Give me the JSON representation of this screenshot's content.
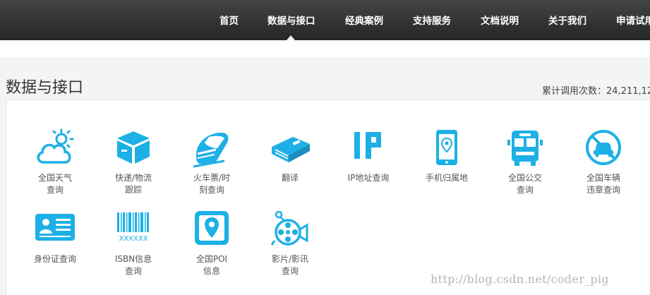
{
  "nav": {
    "items": [
      {
        "label": "首页",
        "active": false
      },
      {
        "label": "数据与接口",
        "active": true
      },
      {
        "label": "经典案例",
        "active": false
      },
      {
        "label": "支持服务",
        "active": false
      },
      {
        "label": "文档说明",
        "active": false
      },
      {
        "label": "关于我们",
        "active": false
      },
      {
        "label": "申请试用",
        "active": false
      }
    ]
  },
  "page": {
    "title": "数据与接口",
    "call_count": "累计调用次数：24,211,12"
  },
  "accent_color": "#1cb0e6",
  "apis": [
    {
      "label": "全国天气\n查询",
      "icon": "cloud-sun-icon"
    },
    {
      "label": "快递/物流\n跟踪",
      "icon": "package-box-icon"
    },
    {
      "label": "火车票/时\n刻查询",
      "icon": "train-icon"
    },
    {
      "label": "翻译",
      "icon": "book-icon"
    },
    {
      "label": "IP地址查询",
      "icon": "ip-icon"
    },
    {
      "label": "手机归属地",
      "icon": "phone-location-icon"
    },
    {
      "label": "全国公交\n查询",
      "icon": "bus-icon"
    },
    {
      "label": "全国车辆\n违章查询",
      "icon": "no-car-icon"
    },
    {
      "label": "身份证查询",
      "icon": "id-card-icon"
    },
    {
      "label": "ISBN信息\n查询",
      "icon": "barcode-icon"
    },
    {
      "label": "全国POI\n信息",
      "icon": "map-pin-icon"
    },
    {
      "label": "影片/影讯\n查询",
      "icon": "film-camera-icon"
    }
  ],
  "watermark": "http://blog.csdn.net/coder_pig"
}
